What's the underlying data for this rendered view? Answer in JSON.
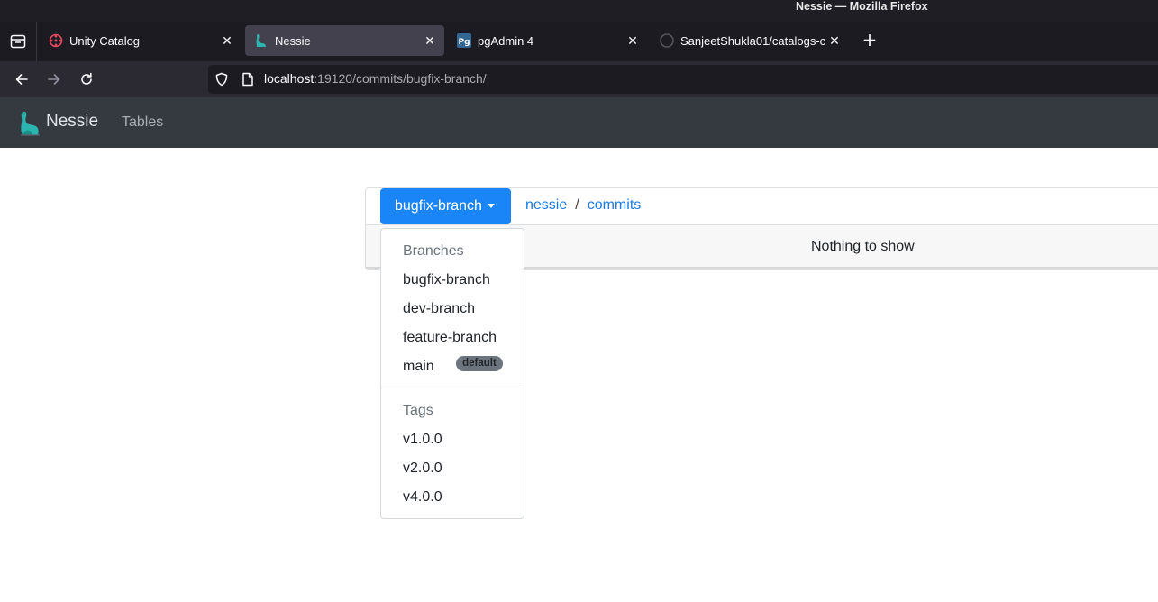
{
  "window": {
    "title": "Nessie — Mozilla Firefox"
  },
  "tabs": [
    {
      "label": "Unity Catalog",
      "active": false
    },
    {
      "label": "Nessie",
      "active": true
    },
    {
      "label": "pgAdmin 4",
      "active": false
    },
    {
      "label": "SanjeetShukla01/catalogs-c",
      "active": false
    }
  ],
  "urlbar": {
    "host": "localhost",
    "path": ":19120/commits/bugfix-branch/"
  },
  "app": {
    "brand": "Nessie",
    "nav_tables": "Tables"
  },
  "branch_button": {
    "label": "bugfix-branch"
  },
  "breadcrumb": {
    "repo": "nessie",
    "separator": "/",
    "section": "commits"
  },
  "content": {
    "empty_message": "Nothing to show"
  },
  "dropdown": {
    "branches_header": "Branches",
    "branches": [
      "bugfix-branch",
      "dev-branch",
      "feature-branch",
      "main"
    ],
    "default_badge": "default",
    "tags_header": "Tags",
    "tags": [
      "v1.0.0",
      "v2.0.0",
      "v4.0.0"
    ]
  },
  "colors": {
    "accent": "#1a85f7",
    "link": "#1a7ce8",
    "header_bg": "#343a40",
    "badge_bg": "#6c757d"
  }
}
